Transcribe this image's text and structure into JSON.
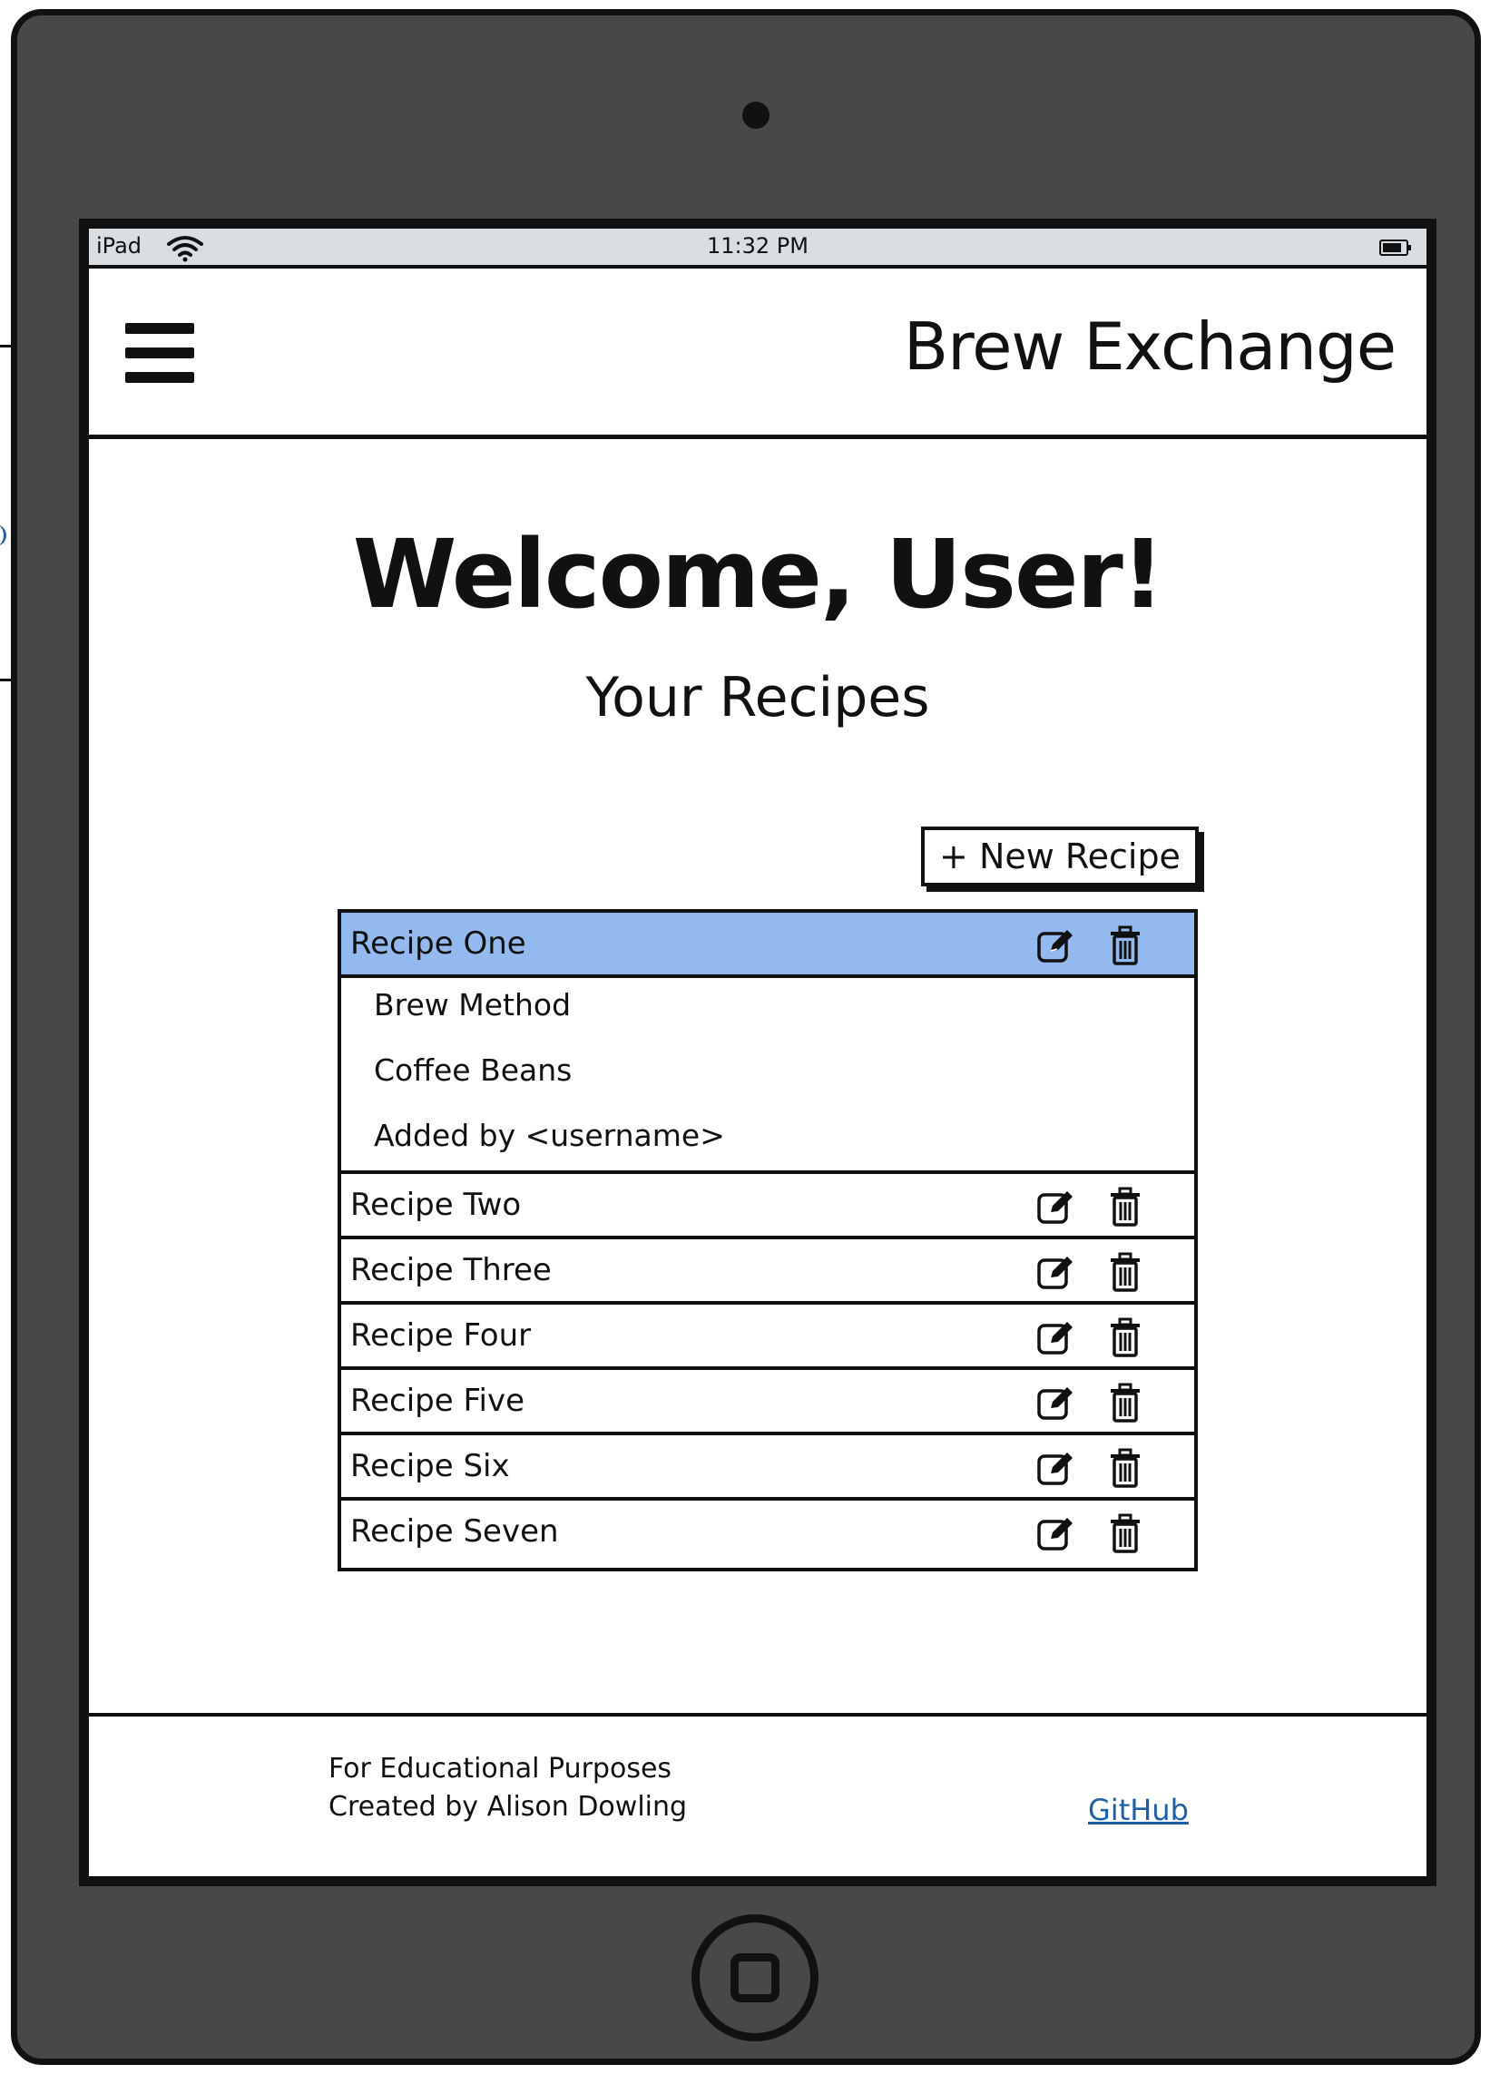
{
  "status_bar": {
    "carrier": "iPad",
    "time": "11:32 PM",
    "wifi_icon": "wifi-icon",
    "battery_icon": "battery-icon"
  },
  "header": {
    "menu_icon": "hamburger-menu-icon",
    "title": "Brew Exchange"
  },
  "main": {
    "welcome": "Welcome, User!",
    "subtitle": "Your Recipes",
    "new_recipe_label": "+ New Recipe"
  },
  "recipes": [
    {
      "name": "Recipe One",
      "selected": true,
      "expanded": true,
      "details": [
        "Brew Method",
        "Coffee Beans",
        "Added by <username>"
      ]
    },
    {
      "name": "Recipe Two"
    },
    {
      "name": "Recipe Three"
    },
    {
      "name": "Recipe Four"
    },
    {
      "name": "Recipe Five"
    },
    {
      "name": "Recipe Six"
    },
    {
      "name": "Recipe Seven"
    }
  ],
  "row_icons": {
    "edit": "edit-icon",
    "delete": "trash-icon"
  },
  "footer": {
    "line1": "For Educational Purposes",
    "line2": "Created by Alison Dowling",
    "link": "GitHub"
  },
  "colors": {
    "device_body": "#484848",
    "status_bar": "#d9dee2",
    "selected_row": "#93b9ef",
    "link": "#1f5fa6",
    "outline": "#111111"
  }
}
